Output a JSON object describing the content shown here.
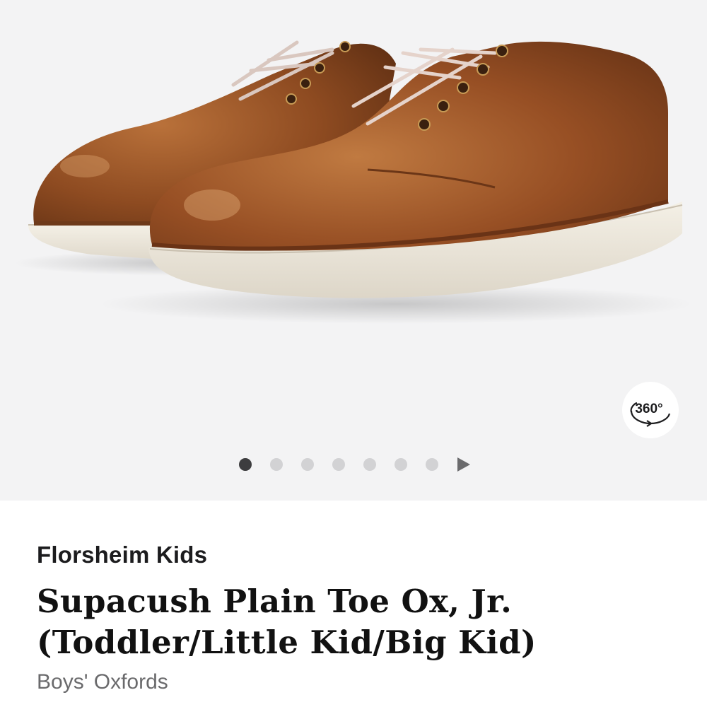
{
  "gallery": {
    "image_alt": "Brown leather plain toe oxford shoes with white soles",
    "view_360_label": "360°",
    "dots_count": 7,
    "active_dot": 0
  },
  "product": {
    "brand": "Florsheim Kids",
    "title_line1": "Supacush Plain Toe Ox, Jr.",
    "title_line2": "(Toddler/Little Kid/Big Kid)",
    "category": "Boys' Oxfords"
  },
  "colors": {
    "leather": "#8a4a22",
    "sole": "#efeae0",
    "background": "#f3f3f4"
  }
}
